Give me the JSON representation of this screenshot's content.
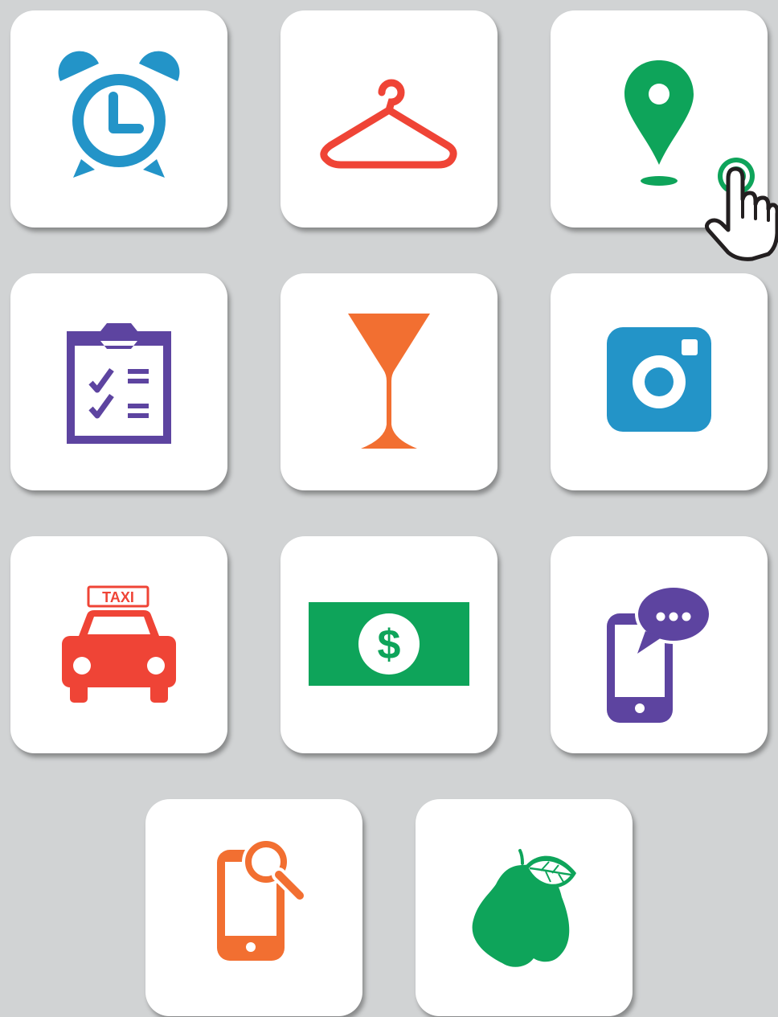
{
  "icons": [
    {
      "name": "alarm-clock-icon",
      "color": "#2394c8"
    },
    {
      "name": "hanger-icon",
      "color": "#ef4436"
    },
    {
      "name": "map-pin-icon",
      "color": "#0ea45a"
    },
    {
      "name": "checklist-icon",
      "color": "#5d44a0"
    },
    {
      "name": "cocktail-glass-icon",
      "color": "#f26f31"
    },
    {
      "name": "camera-icon",
      "color": "#2394c8"
    },
    {
      "name": "taxi-icon",
      "color": "#ef4436",
      "sign_text": "TAXI"
    },
    {
      "name": "dollar-bill-icon",
      "color": "#0ea45a",
      "symbol": "$"
    },
    {
      "name": "phone-chat-icon",
      "color": "#5d44a0"
    },
    {
      "name": "phone-search-icon",
      "color": "#f26f31"
    },
    {
      "name": "pear-icon",
      "color": "#0ea45a"
    }
  ],
  "cursor": {
    "name": "hand-pointer-icon",
    "ring_color": "#0ea45a"
  }
}
